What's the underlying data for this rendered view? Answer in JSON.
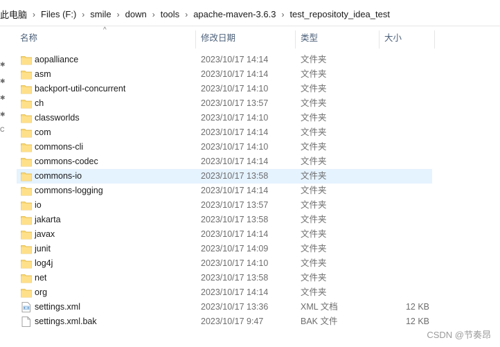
{
  "breadcrumb": [
    "此电脑",
    "Files (F:)",
    "smile",
    "down",
    "tools",
    "apache-maven-3.6.3",
    "test_repositoty_idea_test"
  ],
  "columns": {
    "name": "名称",
    "date": "修改日期",
    "type": "类型",
    "size": "大小"
  },
  "sort_indicator": "^",
  "left_pane_glyphs": [
    "✱",
    "✱",
    "✱",
    "✱",
    "C"
  ],
  "files": [
    {
      "name": "aopalliance",
      "date": "2023/10/17 14:14",
      "type": "文件夹",
      "size": "",
      "icon": "folder-icon"
    },
    {
      "name": "asm",
      "date": "2023/10/17 14:14",
      "type": "文件夹",
      "size": "",
      "icon": "folder-icon"
    },
    {
      "name": "backport-util-concurrent",
      "date": "2023/10/17 14:10",
      "type": "文件夹",
      "size": "",
      "icon": "folder-icon"
    },
    {
      "name": "ch",
      "date": "2023/10/17 13:57",
      "type": "文件夹",
      "size": "",
      "icon": "folder-icon"
    },
    {
      "name": "classworlds",
      "date": "2023/10/17 14:10",
      "type": "文件夹",
      "size": "",
      "icon": "folder-icon"
    },
    {
      "name": "com",
      "date": "2023/10/17 14:14",
      "type": "文件夹",
      "size": "",
      "icon": "folder-icon"
    },
    {
      "name": "commons-cli",
      "date": "2023/10/17 14:10",
      "type": "文件夹",
      "size": "",
      "icon": "folder-icon"
    },
    {
      "name": "commons-codec",
      "date": "2023/10/17 14:14",
      "type": "文件夹",
      "size": "",
      "icon": "folder-icon"
    },
    {
      "name": "commons-io",
      "date": "2023/10/17 13:58",
      "type": "文件夹",
      "size": "",
      "icon": "folder-icon",
      "hover": true
    },
    {
      "name": "commons-logging",
      "date": "2023/10/17 14:14",
      "type": "文件夹",
      "size": "",
      "icon": "folder-icon"
    },
    {
      "name": "io",
      "date": "2023/10/17 13:57",
      "type": "文件夹",
      "size": "",
      "icon": "folder-icon"
    },
    {
      "name": "jakarta",
      "date": "2023/10/17 13:58",
      "type": "文件夹",
      "size": "",
      "icon": "folder-icon"
    },
    {
      "name": "javax",
      "date": "2023/10/17 14:14",
      "type": "文件夹",
      "size": "",
      "icon": "folder-icon"
    },
    {
      "name": "junit",
      "date": "2023/10/17 14:09",
      "type": "文件夹",
      "size": "",
      "icon": "folder-icon"
    },
    {
      "name": "log4j",
      "date": "2023/10/17 14:10",
      "type": "文件夹",
      "size": "",
      "icon": "folder-icon"
    },
    {
      "name": "net",
      "date": "2023/10/17 13:58",
      "type": "文件夹",
      "size": "",
      "icon": "folder-icon"
    },
    {
      "name": "org",
      "date": "2023/10/17 14:14",
      "type": "文件夹",
      "size": "",
      "icon": "folder-icon"
    },
    {
      "name": "settings.xml",
      "date": "2023/10/17 13:36",
      "type": "XML 文档",
      "size": "12 KB",
      "icon": "xml-file-icon"
    },
    {
      "name": "settings.xml.bak",
      "date": "2023/10/17 9:47",
      "type": "BAK 文件",
      "size": "12 KB",
      "icon": "file-icon"
    }
  ],
  "watermark": "CSDN @节奏昂"
}
